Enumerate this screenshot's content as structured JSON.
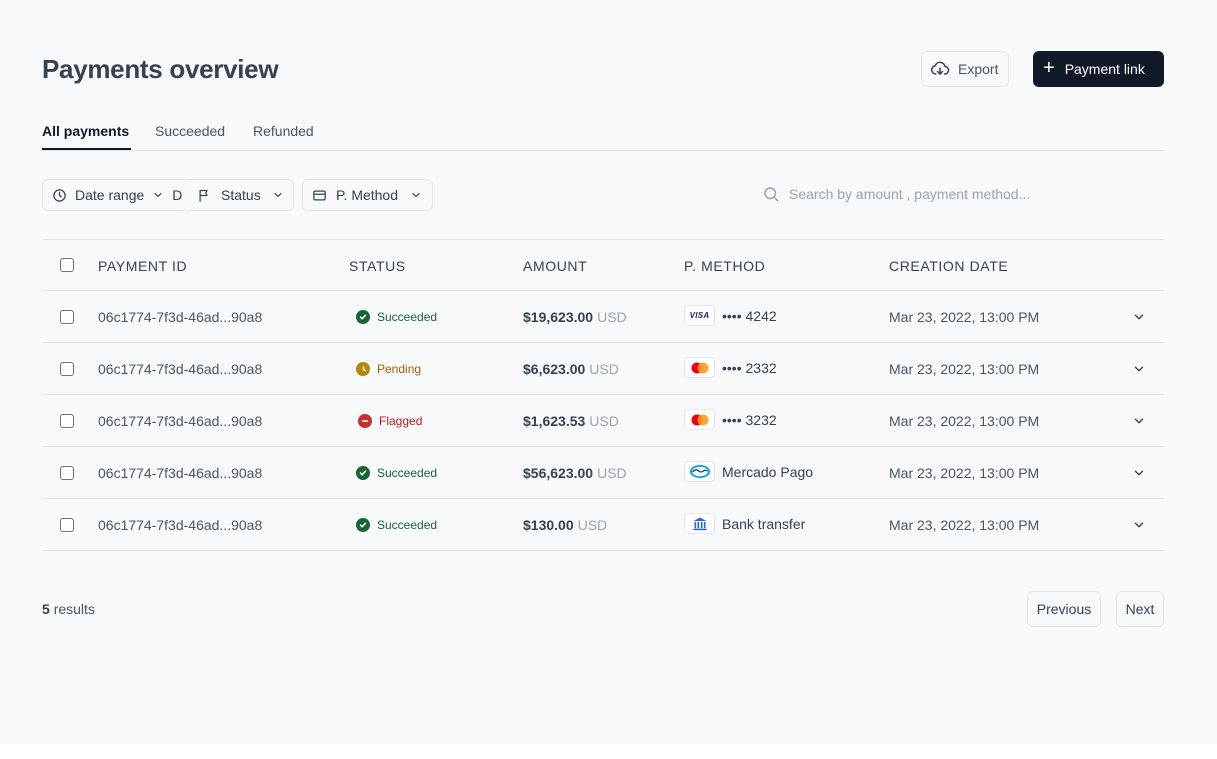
{
  "header": {
    "title": "Payments overview",
    "export_label": "Export",
    "payment_link_label": "Payment link"
  },
  "tabs": [
    {
      "label": "All payments",
      "active": true
    },
    {
      "label": "Succeeded",
      "active": false
    },
    {
      "label": "Refunded",
      "active": false
    }
  ],
  "filters": {
    "date_range": "Date range",
    "date_overflow": "D",
    "status": "Status",
    "method": "P. Method"
  },
  "search": {
    "placeholder": "Search by amount , payment method..."
  },
  "table": {
    "columns": [
      "PAYMENT ID",
      "STATUS",
      "AMOUNT",
      "P. METHOD",
      "CREATION DATE"
    ],
    "rows": [
      {
        "id": "06c1774-7f3d-46ad...90a8",
        "status": "Succeeded",
        "status_icon": "check-circle-icon",
        "amount": "$19,623.00",
        "currency": "USD",
        "method_icon": "visa-icon",
        "method_label": "VISA",
        "method": "•••• 4242",
        "date": "Mar 23, 2022, 13:00 PM"
      },
      {
        "id": "06c1774-7f3d-46ad...90a8",
        "status": "Pending",
        "status_icon": "clock-icon",
        "amount": "$6,623.00",
        "currency": "USD",
        "method_icon": "mastercard-icon",
        "method": "•••• 2332",
        "date": "Mar 23, 2022, 13:00 PM"
      },
      {
        "id": "06c1774-7f3d-46ad...90a8",
        "status": "Flagged",
        "status_icon": "minus-circle-icon",
        "amount": "$1,623.53",
        "currency": "USD",
        "method_icon": "mastercard-icon",
        "method": "•••• 3232",
        "date": "Mar 23, 2022, 13:00 PM"
      },
      {
        "id": "06c1774-7f3d-46ad...90a8",
        "status": "Succeeded",
        "status_icon": "check-circle-icon",
        "amount": "$56,623.00",
        "currency": "USD",
        "method_icon": "mercado-pago-icon",
        "method": "Mercado Pago",
        "date": "Mar 23, 2022, 13:00 PM"
      },
      {
        "id": "06c1774-7f3d-46ad...90a8",
        "status": "Succeeded",
        "status_icon": "check-circle-icon",
        "amount": "$130.00",
        "currency": "USD",
        "method_icon": "bank-icon",
        "method": "Bank transfer",
        "date": "Mar 23, 2022, 13:00 PM"
      }
    ]
  },
  "footer": {
    "count": "5",
    "count_suffix": "results",
    "previous": "Previous",
    "next": "Next"
  },
  "colors": {
    "primary_button": "#111827",
    "succeeded": "#166534",
    "pending": "#a16207",
    "flagged": "#b91c1c",
    "background": "#f8f9fb"
  }
}
